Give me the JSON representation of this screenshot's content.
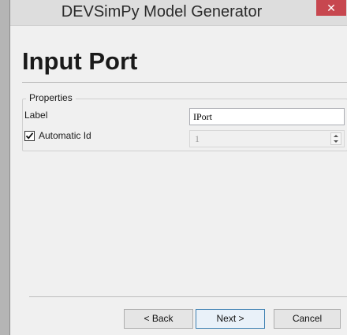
{
  "window": {
    "title": "DEVSimPy Model Generator",
    "close_glyph": "✕"
  },
  "page": {
    "title": "Input Port"
  },
  "properties": {
    "group_label": "Properties",
    "label_field": {
      "label": "Label",
      "value": "IPort"
    },
    "automatic_id": {
      "label": "Automatic Id",
      "checked": true,
      "value": "1"
    }
  },
  "buttons": {
    "back": "< Back",
    "next": "Next >",
    "cancel": "Cancel"
  },
  "colors": {
    "close_button": "#c7474f",
    "default_button_border": "#3c7fb1",
    "title_bar": "#dddddd"
  }
}
